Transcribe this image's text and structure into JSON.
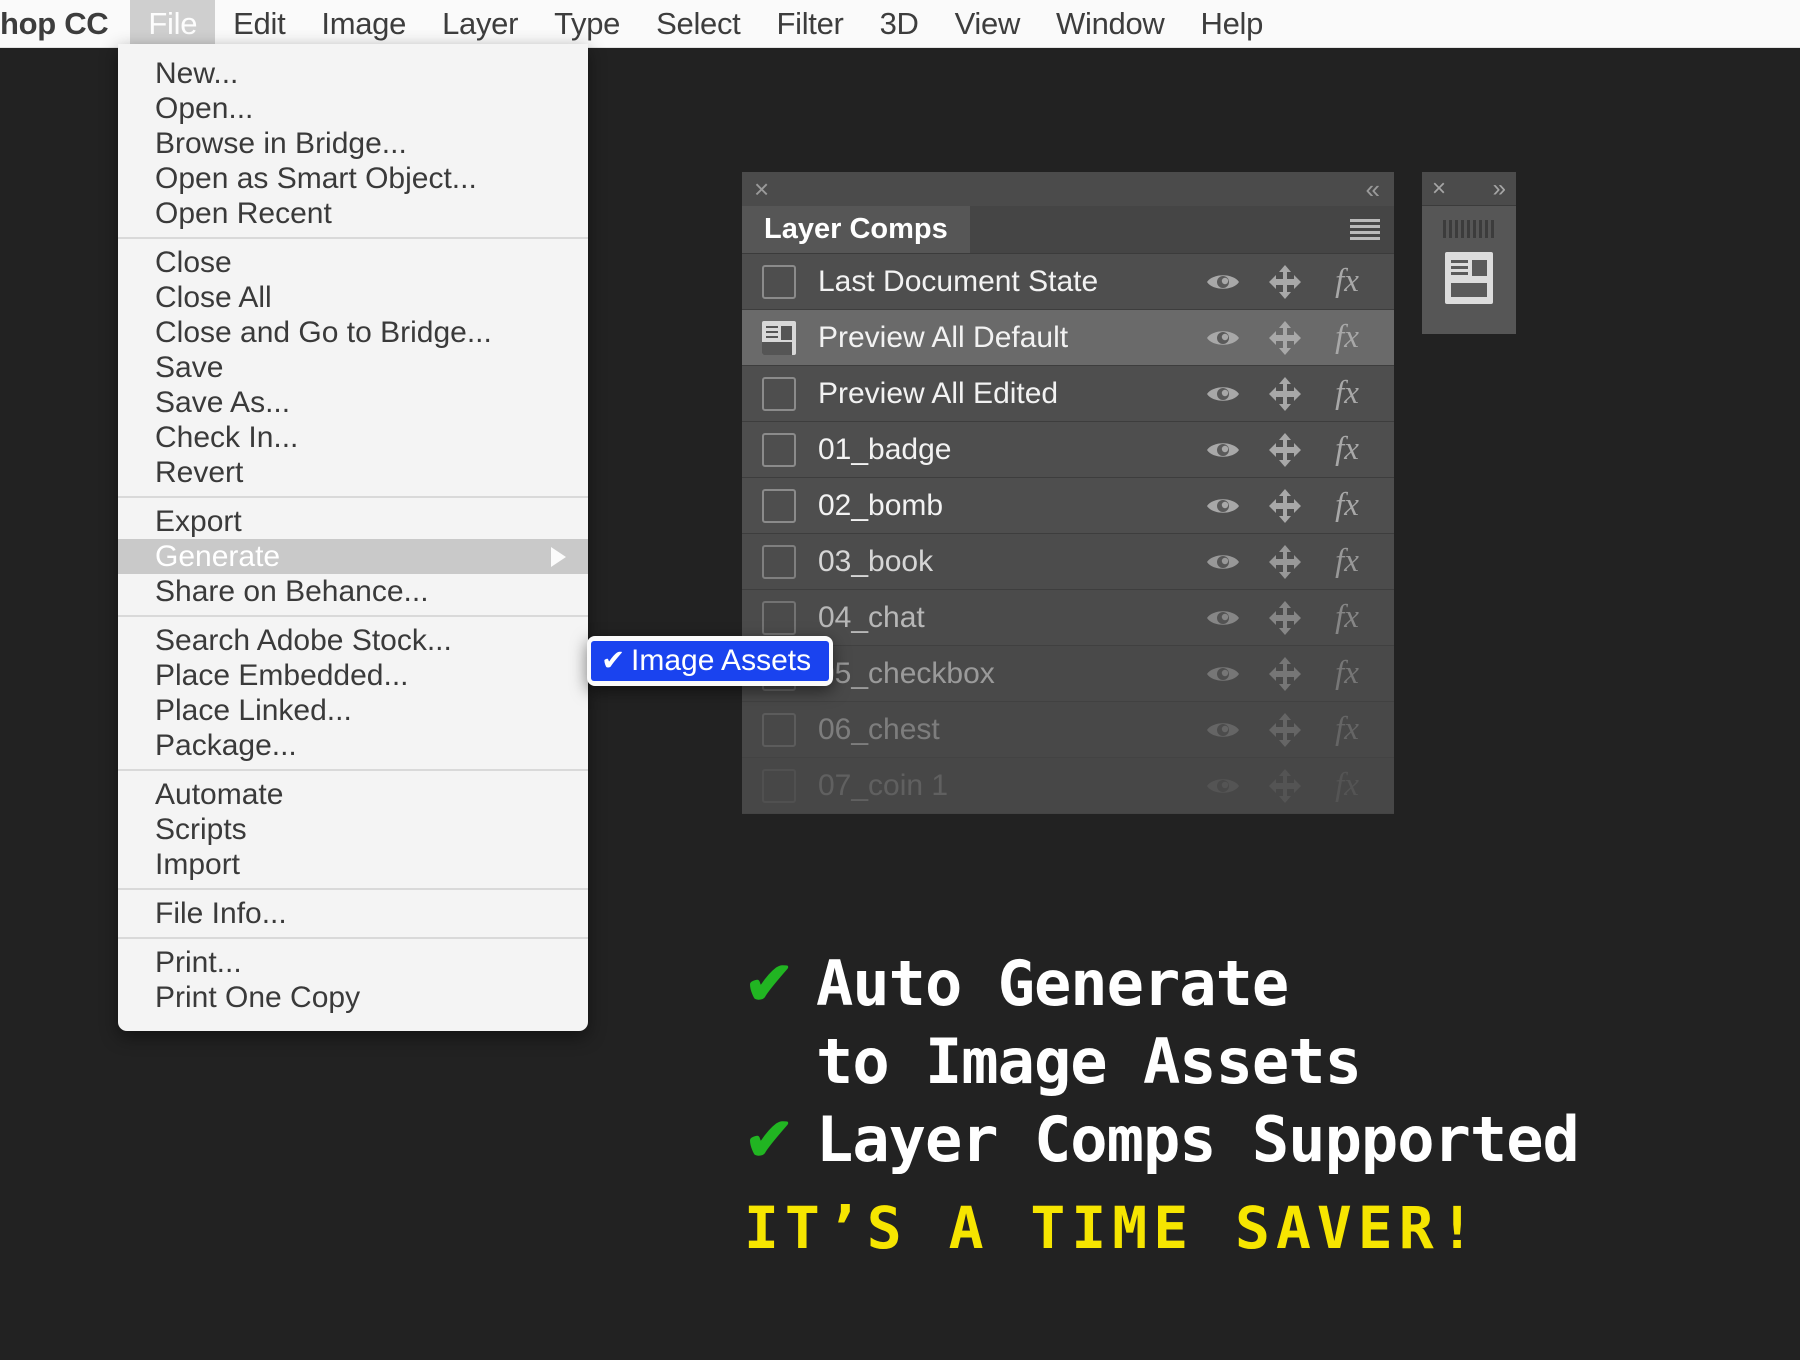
{
  "menubar": {
    "brand": "hop CC",
    "items": [
      {
        "label": "File",
        "active": true
      },
      {
        "label": "Edit",
        "active": false
      },
      {
        "label": "Image",
        "active": false
      },
      {
        "label": "Layer",
        "active": false
      },
      {
        "label": "Type",
        "active": false
      },
      {
        "label": "Select",
        "active": false
      },
      {
        "label": "Filter",
        "active": false
      },
      {
        "label": "3D",
        "active": false
      },
      {
        "label": "View",
        "active": false
      },
      {
        "label": "Window",
        "active": false
      },
      {
        "label": "Help",
        "active": false
      }
    ]
  },
  "file_menu": {
    "groups": [
      [
        "New...",
        "Open...",
        "Browse in Bridge...",
        "Open as Smart Object...",
        "Open Recent"
      ],
      [
        "Close",
        "Close All",
        "Close and Go to Bridge...",
        "Save",
        "Save As...",
        "Check In...",
        "Revert"
      ],
      [
        "Export",
        "Generate",
        "Share on Behance..."
      ],
      [
        "Search Adobe Stock...",
        "Place Embedded...",
        "Place Linked...",
        "Package..."
      ],
      [
        "Automate",
        "Scripts",
        "Import"
      ],
      [
        "File Info..."
      ],
      [
        "Print...",
        "Print One Copy"
      ]
    ],
    "highlighted_item": "Generate"
  },
  "submenu": {
    "check_glyph": "✔",
    "items": [
      "Image Assets"
    ],
    "highlight_color": "#1a43ef"
  },
  "layer_comps_panel": {
    "close_glyph": "×",
    "collapse_glyph": "«",
    "tab_label": "Layer Comps",
    "rows": [
      {
        "label": "Last Document State",
        "selected": false,
        "has_comp_icon": false
      },
      {
        "label": "Preview All Default",
        "selected": true,
        "has_comp_icon": true
      },
      {
        "label": "Preview All Edited",
        "selected": false,
        "has_comp_icon": false
      },
      {
        "label": "01_badge",
        "selected": false,
        "has_comp_icon": false
      },
      {
        "label": "02_bomb",
        "selected": false,
        "has_comp_icon": false
      },
      {
        "label": "03_book",
        "selected": false,
        "has_comp_icon": false
      },
      {
        "label": "04_chat",
        "selected": false,
        "has_comp_icon": false
      },
      {
        "label": "05_checkbox",
        "selected": false,
        "has_comp_icon": false
      },
      {
        "label": "06_chest",
        "selected": false,
        "has_comp_icon": false
      },
      {
        "label": "07_coin 1",
        "selected": false,
        "has_comp_icon": false
      }
    ],
    "row_icons": [
      "eye-icon",
      "move-icon",
      "fx-icon"
    ],
    "fx_label": "fx"
  },
  "mini_panel": {
    "close_glyph": "×",
    "expand_glyph": "»"
  },
  "promo": {
    "check_glyph": "✔",
    "lines": [
      {
        "check": true,
        "text": "Auto Generate"
      },
      {
        "check": false,
        "text": " to Image Assets"
      },
      {
        "check": true,
        "text": "Layer Comps Supported"
      }
    ],
    "tagline": "IT’S A TIME SAVER!",
    "check_color": "#21b522",
    "tagline_color": "#f6e500"
  }
}
